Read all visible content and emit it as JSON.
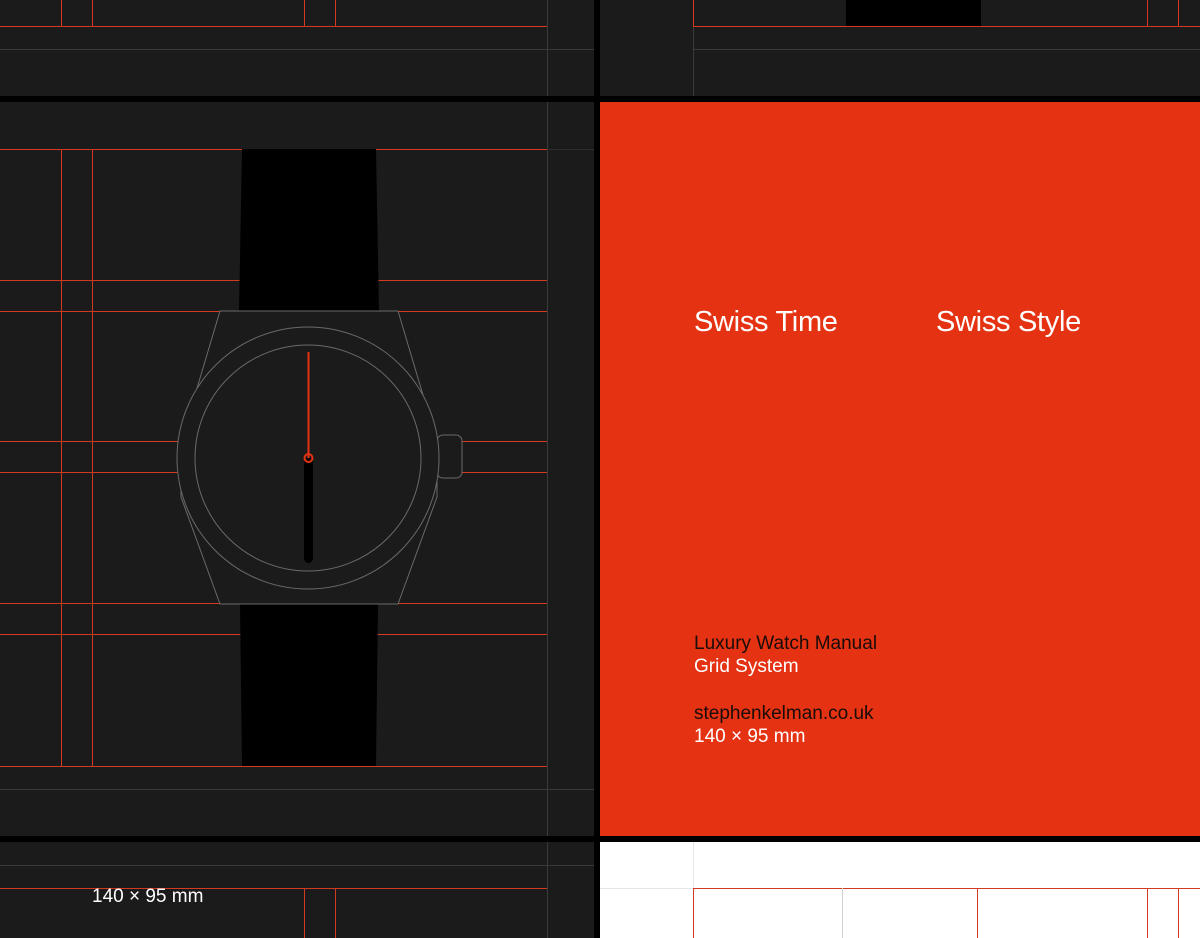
{
  "cover": {
    "title_left": "Swiss Time",
    "title_right": "Swiss Style",
    "subtitle_line1": "Luxury Watch Manual",
    "subtitle_line2": "Grid System",
    "website": "stephenkelman.co.uk",
    "dimensions": "140 × 95 mm"
  },
  "bottom_spread": {
    "dimensions": "140 × 95 mm"
  },
  "colors": {
    "grid_line": "#d23a22",
    "guide_line": "#3a3a3a",
    "panel_dark": "#1b1b1b",
    "cover_orange": "#e43212",
    "strap": "#000000",
    "hand": "#e43212",
    "outline": "#6a6a6a"
  }
}
